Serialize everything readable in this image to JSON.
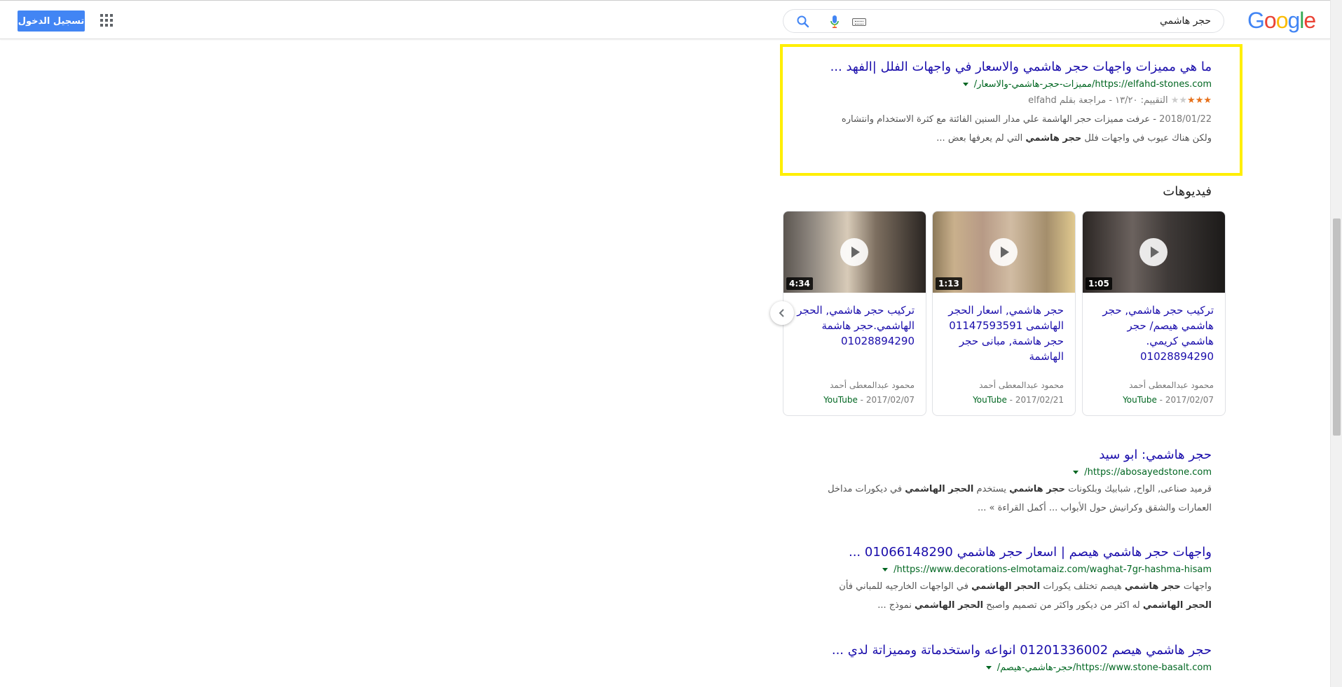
{
  "header": {
    "signin_label": "تسجيل الدخول",
    "search_query": "حجر هاشمي",
    "logo_letters": [
      {
        "ch": "G",
        "color": "#4285F4"
      },
      {
        "ch": "o",
        "color": "#EA4335"
      },
      {
        "ch": "o",
        "color": "#FBBC05"
      },
      {
        "ch": "g",
        "color": "#4285F4"
      },
      {
        "ch": "l",
        "color": "#34A853"
      },
      {
        "ch": "e",
        "color": "#EA4335"
      }
    ],
    "icons": [
      "apps-grid-icon",
      "keyboard-icon",
      "mic-icon",
      "search-icon"
    ]
  },
  "result1": {
    "title": "ما هي مميزات واجهات حجر هاشمي والاسعار في واجهات الفلل |الفهد ...",
    "url": "https://elfahd-stones.com/مميزات-حجر-هاشمي-والاسعار/",
    "rating_label": "التقييم: ١٣/٢٠ - مراجعة بقلم elfahd",
    "stars_filled": 3,
    "stars_total": 5,
    "date": "2018/01/22",
    "snippet_line1": " - عرفت مميزات حجر الهاشمة علي مدار السنين الفائتة مع كثرة الاستخدام وانتشاره",
    "snippet_line2_pre": "ولكن هناك عيوب في واجهات فلل ",
    "snippet_line2_bold": "حجر هاشمي",
    "snippet_line2_post": " التي لم يعرفها بعض ..."
  },
  "videos": {
    "heading": "فيديوهات",
    "cards": [
      {
        "duration": "1:05",
        "title": "تركيب حجر هاشمي, حجر هاشمي هيصم/ حجر هاشمي كريمي. 01028894290",
        "author": "محمود عبدالمعطى أحمد",
        "source": "YouTube",
        "date": "2017/02/07"
      },
      {
        "duration": "1:13",
        "title": "حجر هاشمي, اسعار الحجر الهاشمى 01147593591 حجر هاشمة, مبانى حجر الهاشمة",
        "author": "محمود عبدالمعطى أحمد",
        "source": "YouTube",
        "date": "2017/02/21"
      },
      {
        "duration": "4:34",
        "title": "تركيب حجر هاشمي, الحجر الهاشمي.حجر هاشمة 01028894290",
        "author": "محمود عبدالمعطى أحمد",
        "source": "YouTube",
        "date": "2017/02/07"
      }
    ]
  },
  "result2": {
    "title": "حجر هاشمي: ابو سيد",
    "url": "https://abosayedstone.com/",
    "l1_pre": "قرميد صناعى, الواح, شبابيك وبلكونات ",
    "l1_b1": "حجر هاشمي",
    "l1_mid": " يستخدم ",
    "l1_b2": "الحجر الهاشمي",
    "l1_post": " في ديكورات مداخل",
    "l2": "العمارات والشقق وكرانيش حول الأبواب ... أكمل القراءة » ..."
  },
  "result3": {
    "title": "واجهات حجر هاشمي هيصم | اسعار حجر هاشمي 01066148290 ...",
    "url": "https://www.decorations-elmotamaiz.com/waghat-7gr-hashma-hisam/",
    "l1_pre": "واجهات ",
    "l1_b1": "حجر هاشمي",
    "l1_mid": " هيصم  تختلف يكورات ",
    "l1_b2": "الحجر الهاشمي",
    "l1_post": " في الواجهات الخارجيه للمباني فأن",
    "l2_b1": "الحجر الهاشمي",
    "l2_mid": " له اكثر من ديكور واكثر من تصميم واصبح ",
    "l2_b2": "الحجر الهاشمي",
    "l2_post": " نموذج ..."
  },
  "result4": {
    "title": "حجر هاشمي هيصم 01201336002 انواعه واستخدماتة ومميزاتة لدي ...",
    "url": "https://www.stone-basalt.com/حجر-هاشمي-هيصم/"
  },
  "colors": {
    "link": "#1a0dab",
    "url_green": "#006621",
    "snippet": "#545454",
    "highlight": "#ffef00",
    "signin_blue": "#4285f4"
  }
}
